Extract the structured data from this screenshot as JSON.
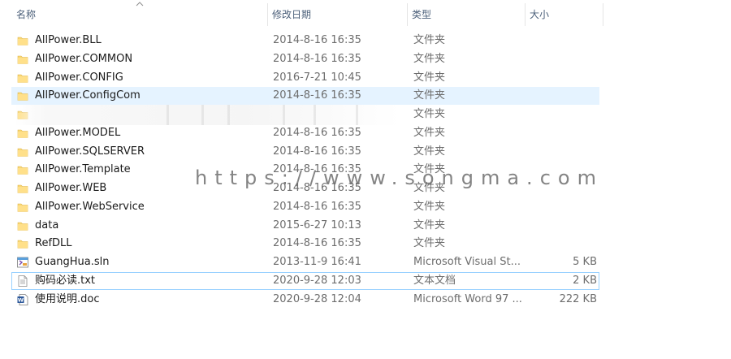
{
  "columns": {
    "name": "名称",
    "date": "修改日期",
    "type": "类型",
    "size": "大小"
  },
  "files": [
    {
      "name": "AllPower.BLL",
      "date": "2014-8-16 16:35",
      "type": "文件夹",
      "size": "",
      "icon": "folder-icon"
    },
    {
      "name": "AllPower.COMMON",
      "date": "2014-8-16 16:35",
      "type": "文件夹",
      "size": "",
      "icon": "folder-icon"
    },
    {
      "name": "AllPower.CONFIG",
      "date": "2016-7-21 10:45",
      "type": "文件夹",
      "size": "",
      "icon": "folder-icon"
    },
    {
      "name": "AllPower.ConfigCom",
      "date": "2014-8-16 16:35",
      "type": "文件夹",
      "size": "",
      "icon": "folder-icon"
    },
    {
      "name": "",
      "date": "",
      "type": "文件夹",
      "size": "",
      "icon": "folder-icon"
    },
    {
      "name": "AllPower.MODEL",
      "date": "2014-8-16 16:35",
      "type": "文件夹",
      "size": "",
      "icon": "folder-icon"
    },
    {
      "name": "AllPower.SQLSERVER",
      "date": "2014-8-16 16:35",
      "type": "文件夹",
      "size": "",
      "icon": "folder-icon"
    },
    {
      "name": "AllPower.Template",
      "date": "2014-8-16 16:35",
      "type": "文件夹",
      "size": "",
      "icon": "folder-icon"
    },
    {
      "name": "AllPower.WEB",
      "date": "2014-8-16 16:35",
      "type": "文件夹",
      "size": "",
      "icon": "folder-icon"
    },
    {
      "name": "AllPower.WebService",
      "date": "2014-8-16 16:35",
      "type": "文件夹",
      "size": "",
      "icon": "folder-icon"
    },
    {
      "name": "data",
      "date": "2015-6-27 10:13",
      "type": "文件夹",
      "size": "",
      "icon": "folder-icon"
    },
    {
      "name": "RefDLL",
      "date": "2014-8-16 16:35",
      "type": "文件夹",
      "size": "",
      "icon": "folder-icon"
    },
    {
      "name": "GuangHua.sln",
      "date": "2013-11-9 16:41",
      "type": "Microsoft Visual St...",
      "size": "5 KB",
      "icon": "visual-studio-solution-icon"
    },
    {
      "name": "购码必读.txt",
      "date": "2020-9-28 12:03",
      "type": "文本文档",
      "size": "2 KB",
      "icon": "text-document-icon"
    },
    {
      "name": "使用说明.doc",
      "date": "2020-9-28 12:04",
      "type": "Microsoft Word 97 ...",
      "size": "222 KB",
      "icon": "word-document-icon"
    }
  ],
  "hover_row": 3,
  "focus_row": 13,
  "watermark": "https://www.songma.com",
  "colors": {
    "folder": "#f8d775",
    "hover": "#e5f3ff",
    "focus_border": "#99d1ff",
    "header_text": "#4c607a"
  }
}
